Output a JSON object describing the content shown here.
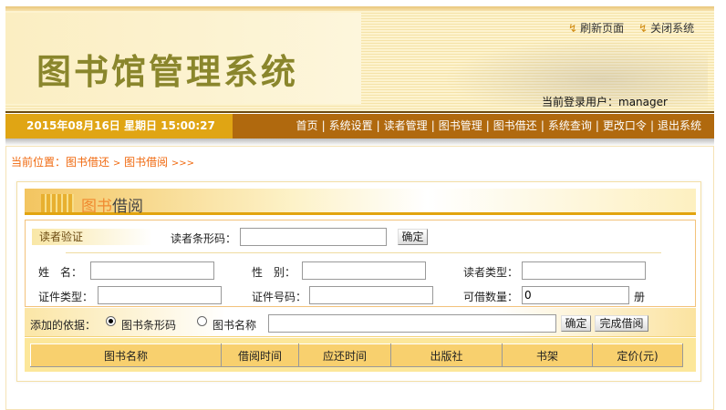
{
  "header": {
    "title": "图书馆管理系统",
    "refresh": "刷新页面",
    "close": "关闭系统",
    "current_user_label": "当前登录用户：",
    "current_user": "manager"
  },
  "nav": {
    "datetime": "2015年08月16日 星期日 15:00:27",
    "items": [
      "首页",
      "系统设置",
      "读者管理",
      "图书管理",
      "图书借还",
      "系统查询",
      "更改口令",
      "退出系统"
    ]
  },
  "breadcrumb": {
    "prefix": "当前位置：",
    "level1": "图书借还",
    "sep": ">",
    "level2": "图书借阅",
    "tail": ">>>"
  },
  "panel": {
    "title_a": "图书",
    "title_b": "借阅"
  },
  "reader": {
    "section": "读者验证",
    "barcode_label": "读者条形码：",
    "barcode_value": "",
    "confirm": "确定",
    "name_label": "姓　名：",
    "gender_label": "性　别：",
    "type_label": "读者类型：",
    "idtype_label": "证件类型：",
    "idno_label": "证件号码：",
    "count_label": "可借数量：",
    "count_value": "0",
    "count_unit": "册"
  },
  "add": {
    "label": "添加的依据：",
    "opt_barcode": "图书条形码",
    "opt_name": "图书名称",
    "selected": "图书条形码",
    "value": "",
    "confirm": "确定",
    "finish": "完成借阅"
  },
  "table": {
    "columns": [
      "图书名称",
      "借阅时间",
      "应还时间",
      "出版社",
      "书架",
      "定价(元)"
    ]
  }
}
